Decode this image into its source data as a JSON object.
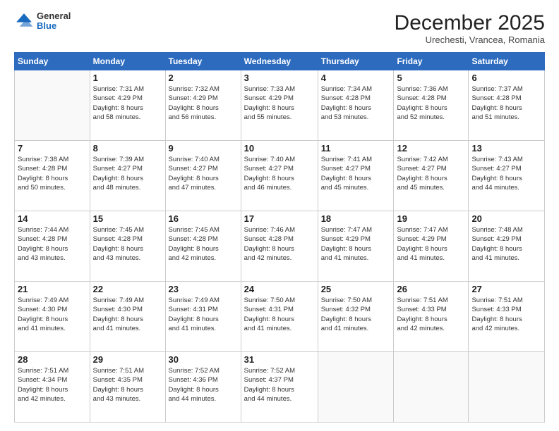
{
  "logo": {
    "general": "General",
    "blue": "Blue"
  },
  "header": {
    "month": "December 2025",
    "location": "Urechesti, Vrancea, Romania"
  },
  "weekdays": [
    "Sunday",
    "Monday",
    "Tuesday",
    "Wednesday",
    "Thursday",
    "Friday",
    "Saturday"
  ],
  "weeks": [
    [
      {
        "day": "",
        "info": ""
      },
      {
        "day": "1",
        "info": "Sunrise: 7:31 AM\nSunset: 4:29 PM\nDaylight: 8 hours\nand 58 minutes."
      },
      {
        "day": "2",
        "info": "Sunrise: 7:32 AM\nSunset: 4:29 PM\nDaylight: 8 hours\nand 56 minutes."
      },
      {
        "day": "3",
        "info": "Sunrise: 7:33 AM\nSunset: 4:29 PM\nDaylight: 8 hours\nand 55 minutes."
      },
      {
        "day": "4",
        "info": "Sunrise: 7:34 AM\nSunset: 4:28 PM\nDaylight: 8 hours\nand 53 minutes."
      },
      {
        "day": "5",
        "info": "Sunrise: 7:36 AM\nSunset: 4:28 PM\nDaylight: 8 hours\nand 52 minutes."
      },
      {
        "day": "6",
        "info": "Sunrise: 7:37 AM\nSunset: 4:28 PM\nDaylight: 8 hours\nand 51 minutes."
      }
    ],
    [
      {
        "day": "7",
        "info": "Sunrise: 7:38 AM\nSunset: 4:28 PM\nDaylight: 8 hours\nand 50 minutes."
      },
      {
        "day": "8",
        "info": "Sunrise: 7:39 AM\nSunset: 4:27 PM\nDaylight: 8 hours\nand 48 minutes."
      },
      {
        "day": "9",
        "info": "Sunrise: 7:40 AM\nSunset: 4:27 PM\nDaylight: 8 hours\nand 47 minutes."
      },
      {
        "day": "10",
        "info": "Sunrise: 7:40 AM\nSunset: 4:27 PM\nDaylight: 8 hours\nand 46 minutes."
      },
      {
        "day": "11",
        "info": "Sunrise: 7:41 AM\nSunset: 4:27 PM\nDaylight: 8 hours\nand 45 minutes."
      },
      {
        "day": "12",
        "info": "Sunrise: 7:42 AM\nSunset: 4:27 PM\nDaylight: 8 hours\nand 45 minutes."
      },
      {
        "day": "13",
        "info": "Sunrise: 7:43 AM\nSunset: 4:27 PM\nDaylight: 8 hours\nand 44 minutes."
      }
    ],
    [
      {
        "day": "14",
        "info": "Sunrise: 7:44 AM\nSunset: 4:28 PM\nDaylight: 8 hours\nand 43 minutes."
      },
      {
        "day": "15",
        "info": "Sunrise: 7:45 AM\nSunset: 4:28 PM\nDaylight: 8 hours\nand 43 minutes."
      },
      {
        "day": "16",
        "info": "Sunrise: 7:45 AM\nSunset: 4:28 PM\nDaylight: 8 hours\nand 42 minutes."
      },
      {
        "day": "17",
        "info": "Sunrise: 7:46 AM\nSunset: 4:28 PM\nDaylight: 8 hours\nand 42 minutes."
      },
      {
        "day": "18",
        "info": "Sunrise: 7:47 AM\nSunset: 4:29 PM\nDaylight: 8 hours\nand 41 minutes."
      },
      {
        "day": "19",
        "info": "Sunrise: 7:47 AM\nSunset: 4:29 PM\nDaylight: 8 hours\nand 41 minutes."
      },
      {
        "day": "20",
        "info": "Sunrise: 7:48 AM\nSunset: 4:29 PM\nDaylight: 8 hours\nand 41 minutes."
      }
    ],
    [
      {
        "day": "21",
        "info": "Sunrise: 7:49 AM\nSunset: 4:30 PM\nDaylight: 8 hours\nand 41 minutes."
      },
      {
        "day": "22",
        "info": "Sunrise: 7:49 AM\nSunset: 4:30 PM\nDaylight: 8 hours\nand 41 minutes."
      },
      {
        "day": "23",
        "info": "Sunrise: 7:49 AM\nSunset: 4:31 PM\nDaylight: 8 hours\nand 41 minutes."
      },
      {
        "day": "24",
        "info": "Sunrise: 7:50 AM\nSunset: 4:31 PM\nDaylight: 8 hours\nand 41 minutes."
      },
      {
        "day": "25",
        "info": "Sunrise: 7:50 AM\nSunset: 4:32 PM\nDaylight: 8 hours\nand 41 minutes."
      },
      {
        "day": "26",
        "info": "Sunrise: 7:51 AM\nSunset: 4:33 PM\nDaylight: 8 hours\nand 42 minutes."
      },
      {
        "day": "27",
        "info": "Sunrise: 7:51 AM\nSunset: 4:33 PM\nDaylight: 8 hours\nand 42 minutes."
      }
    ],
    [
      {
        "day": "28",
        "info": "Sunrise: 7:51 AM\nSunset: 4:34 PM\nDaylight: 8 hours\nand 42 minutes."
      },
      {
        "day": "29",
        "info": "Sunrise: 7:51 AM\nSunset: 4:35 PM\nDaylight: 8 hours\nand 43 minutes."
      },
      {
        "day": "30",
        "info": "Sunrise: 7:52 AM\nSunset: 4:36 PM\nDaylight: 8 hours\nand 44 minutes."
      },
      {
        "day": "31",
        "info": "Sunrise: 7:52 AM\nSunset: 4:37 PM\nDaylight: 8 hours\nand 44 minutes."
      },
      {
        "day": "",
        "info": ""
      },
      {
        "day": "",
        "info": ""
      },
      {
        "day": "",
        "info": ""
      }
    ]
  ]
}
